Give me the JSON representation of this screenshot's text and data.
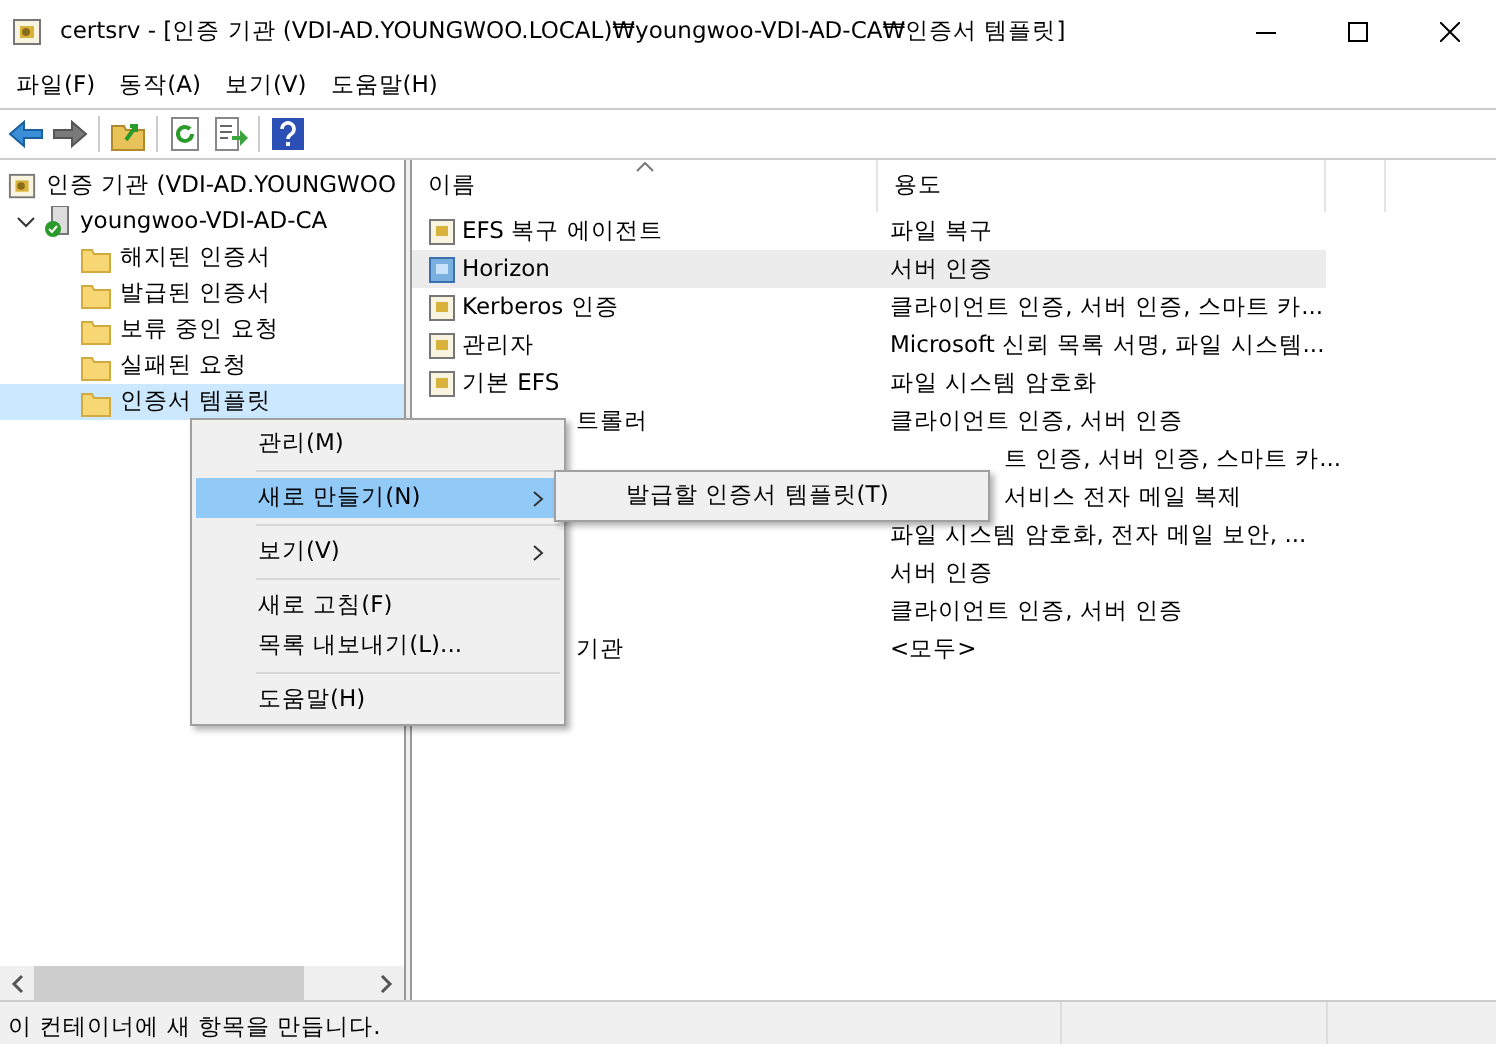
{
  "window": {
    "title": "certsrv - [인증 기관 (VDI-AD.YOUNGWOO.LOCAL)₩youngwoo-VDI-AD-CA₩인증서 템플릿]"
  },
  "menu_bar": [
    "파일(F)",
    "동작(A)",
    "보기(V)",
    "도움말(H)"
  ],
  "tree": {
    "label": "인증 기관 (VDI-AD.YOUNGWOO",
    "selected": false,
    "children": [
      {
        "label": "youngwoo-VDI-AD-CA",
        "expanded": true,
        "selected": false,
        "children": [
          {
            "label": "해지된 인증서",
            "selected": false
          },
          {
            "label": "발급된 인증서",
            "selected": false
          },
          {
            "label": "보류 중인 요청",
            "selected": false
          },
          {
            "label": "실패된 요청",
            "selected": false
          },
          {
            "label": "인증서 템플릿",
            "selected": true
          }
        ]
      }
    ]
  },
  "table": {
    "columns": [
      "이름",
      "용도"
    ],
    "rows": [
      {
        "name": "EFS 복구 에이전트",
        "usage": "파일 복구",
        "selected": false
      },
      {
        "name": "Horizon",
        "usage": "서버 인증",
        "selected": true
      },
      {
        "name": "Kerberos 인증",
        "usage": "클라이언트 인증, 서버 인증, 스마트 카...",
        "selected": false
      },
      {
        "name": "관리자",
        "usage": "Microsoft 신뢰 목록 서명, 파일 시스템...",
        "selected": false
      },
      {
        "name": "기본 EFS",
        "usage": "파일 시스템 암호화",
        "selected": false
      },
      {
        "name": "트롤러",
        "usage": "클라이언트 인증, 서버 인증",
        "selected": false
      },
      {
        "usage": "트 인증, 서버 인증, 스마트 카...",
        "selected": false
      },
      {
        "usage": "서비스 전자 메일 복제",
        "selected": false
      },
      {
        "usage": "파일 시스템 암호화, 전자 메일 보안, ...",
        "selected": false
      },
      {
        "usage": "서버 인증",
        "selected": false
      },
      {
        "usage": "클라이언트 인증, 서버 인증",
        "selected": false
      },
      {
        "name": "기관",
        "usage": "<모두>",
        "selected": false
      }
    ]
  },
  "context_menu": [
    {
      "kind": "item",
      "label": "관리(M)",
      "selected": false,
      "submenu": false
    },
    {
      "kind": "separator"
    },
    {
      "kind": "item",
      "label": "새로 만들기(N)",
      "selected": true,
      "submenu": true
    },
    {
      "kind": "separator"
    },
    {
      "kind": "item",
      "label": "보기(V)",
      "selected": false,
      "submenu": true
    },
    {
      "kind": "separator"
    },
    {
      "kind": "item",
      "label": "새로 고침(F)",
      "selected": false,
      "submenu": false
    },
    {
      "kind": "item",
      "label": "목록 내보내기(L)...",
      "selected": false,
      "submenu": false
    },
    {
      "kind": "separator"
    },
    {
      "kind": "item",
      "label": "도움말(H)",
      "selected": false,
      "submenu": false
    }
  ],
  "submenu": [
    "발급할 인증서 템플릿(T)"
  ],
  "status_bar": "이 컨테이너에 새 항목을 만듭니다."
}
